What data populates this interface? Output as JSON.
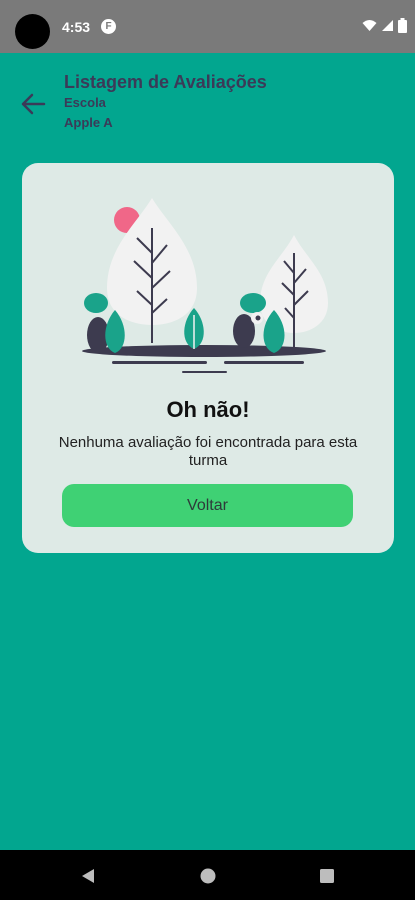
{
  "status_bar": {
    "time": "4:53",
    "notification_badge": "F",
    "icons": [
      "wifi-icon",
      "signal-icon",
      "battery-icon"
    ]
  },
  "header": {
    "title": "Listagem de Avaliações",
    "subtitle_line1": "Escola",
    "subtitle_line2": "Apple A"
  },
  "empty_state": {
    "title": "Oh não!",
    "message": "Nenhuma avaliação foi encontrada para esta turma",
    "button_label": "Voltar",
    "illustration": "empty-forest-illustration"
  },
  "nav_bar": {
    "icons": [
      "back-triangle-icon",
      "home-circle-icon",
      "recents-square-icon"
    ]
  },
  "colors": {
    "background": "#02a68f",
    "card": "#deeae6",
    "button": "#3fd174",
    "header_text": "#3b3a58",
    "status_bar": "#7a7a7a"
  }
}
